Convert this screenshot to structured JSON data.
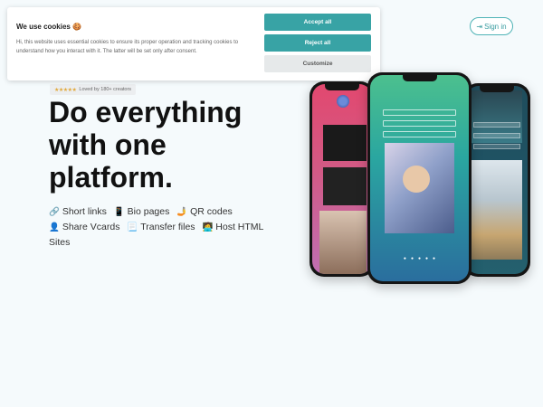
{
  "header": {
    "signin_label": "Sign in",
    "signin_icon": "login-icon"
  },
  "cookie_banner": {
    "title": "We use cookies",
    "title_emoji": "🍪",
    "text": "Hi, this website uses essential cookies to ensure its proper operation and tracking cookies to understand how you interact with it. The latter will be set only after consent.",
    "accept_label": "Accept all",
    "reject_label": "Reject all",
    "customize_label": "Customize"
  },
  "hero": {
    "badge_stars": "★★★★★",
    "badge_text": "Loved by 180+ creators",
    "title_line1": "Do everything",
    "title_line2": "with one",
    "title_line3": "platform.",
    "features": [
      {
        "emoji": "🔗",
        "label": "Short links"
      },
      {
        "emoji": "📱",
        "label": "Bio pages"
      },
      {
        "emoji": "🤳",
        "label": "QR codes"
      },
      {
        "emoji": "👤",
        "label": "Share Vcards"
      },
      {
        "emoji": "📃",
        "label": "Transfer files"
      },
      {
        "emoji": "🧑‍💻",
        "label": "Host HTML Sites"
      }
    ]
  },
  "colors": {
    "accent": "#38a3a5",
    "page_bg": "#f5fafc"
  }
}
